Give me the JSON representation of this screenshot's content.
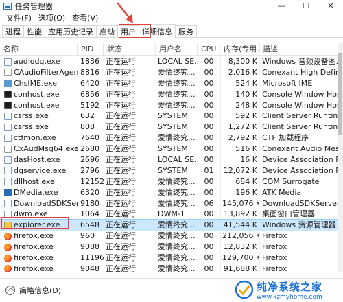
{
  "window": {
    "title": "任务管理器",
    "minimize": "—",
    "maximize": "☐",
    "close": "✕"
  },
  "menu": [
    "文件(F)",
    "选项(O)",
    "查看(V)"
  ],
  "tabs": [
    "进程",
    "性能",
    "应用历史记录",
    "启动",
    "用户",
    "详细信息",
    "服务"
  ],
  "active_tab_index": 5,
  "columns": [
    "名称",
    "PID",
    "状态",
    "用户名",
    "CPU",
    "内存(专用...",
    "描述"
  ],
  "rows": [
    {
      "icon": "speaker-icon",
      "name": "audiodg.exe",
      "pid": "1836",
      "status": "正在运行",
      "user": "LOCAL SE...",
      "cpu": "00",
      "mem": "8,300 K",
      "desc": "Windows 音频设备图..."
    },
    {
      "icon": "conexant-icon",
      "name": "CAudioFilterAgent...",
      "pid": "8816",
      "status": "正在运行",
      "user": "爱情终究...",
      "cpu": "00",
      "mem": "2,016 K",
      "desc": "Conexant High Definiti..."
    },
    {
      "icon": "ime-icon",
      "name": "ChsIME.exe",
      "pid": "6420",
      "status": "正在运行",
      "user": "爱情终究...",
      "cpu": "00",
      "mem": "524 K",
      "desc": "Microsoft IME"
    },
    {
      "icon": "console-icon",
      "name": "conhost.exe",
      "pid": "6856",
      "status": "正在运行",
      "user": "爱情终究...",
      "cpu": "00",
      "mem": "140 K",
      "desc": "Console Window Host"
    },
    {
      "icon": "console-icon",
      "name": "conhost.exe",
      "pid": "5192",
      "status": "正在运行",
      "user": "爱情终究...",
      "cpu": "00",
      "mem": "248 K",
      "desc": "Console Window Host"
    },
    {
      "icon": "system-process-icon",
      "name": "csrss.exe",
      "pid": "632",
      "status": "正在运行",
      "user": "SYSTEM",
      "cpu": "00",
      "mem": "592 K",
      "desc": "Client Server Runtime ..."
    },
    {
      "icon": "system-process-icon",
      "name": "csrss.exe",
      "pid": "808",
      "status": "正在运行",
      "user": "SYSTEM",
      "cpu": "00",
      "mem": "1,272 K",
      "desc": "Client Server Runtime ..."
    },
    {
      "icon": "ctf-icon",
      "name": "ctfmon.exe",
      "pid": "7640",
      "status": "正在运行",
      "user": "爱情终究...",
      "cpu": "00",
      "mem": "2,792 K",
      "desc": "CTF 加载程序"
    },
    {
      "icon": "conexant-icon",
      "name": "CxAudMsg64.exe",
      "pid": "2680",
      "status": "正在运行",
      "user": "SYSTEM",
      "cpu": "00",
      "mem": "516 K",
      "desc": "Conexant Audio Mess..."
    },
    {
      "icon": "system-process-icon",
      "name": "dasHost.exe",
      "pid": "2696",
      "status": "正在运行",
      "user": "LOCAL SE...",
      "cpu": "00",
      "mem": "16 K",
      "desc": "Device Association Fr..."
    },
    {
      "icon": "system-process-icon",
      "name": "dgservice.exe",
      "pid": "2796",
      "status": "正在运行",
      "user": "SYSTEM",
      "cpu": "01",
      "mem": "12,072 K",
      "desc": "Device Association Fr..."
    },
    {
      "icon": "system-process-icon",
      "name": "dllhost.exe",
      "pid": "12152",
      "status": "正在运行",
      "user": "爱情终究...",
      "cpu": "00",
      "mem": "684 K",
      "desc": "COM Surrogate"
    },
    {
      "icon": "dmedia-icon",
      "name": "DMedia.exe",
      "pid": "6320",
      "status": "正在运行",
      "user": "爱情终究...",
      "cpu": "00",
      "mem": "196 K",
      "desc": "ATK Media"
    },
    {
      "icon": "download-icon",
      "name": "DownloadSDKServ...",
      "pid": "9180",
      "status": "正在运行",
      "user": "爱情终究...",
      "cpu": "06",
      "mem": "145,076 K",
      "desc": "DownloadSDKServer"
    },
    {
      "icon": "dwm-icon",
      "name": "dwm.exe",
      "pid": "1064",
      "status": "正在运行",
      "user": "DWM-1",
      "cpu": "00",
      "mem": "13,892 K",
      "desc": "桌面窗口管理器"
    },
    {
      "icon": "folder-icon",
      "name": "explorer.exe",
      "pid": "6548",
      "status": "正在运行",
      "user": "爱情终究...",
      "cpu": "00",
      "mem": "41,544 K",
      "desc": "Windows 资源管理器"
    },
    {
      "icon": "firefox-icon",
      "name": "firefox.exe",
      "pid": "960",
      "status": "正在运行",
      "user": "爱情终究...",
      "cpu": "00",
      "mem": "212,056 K",
      "desc": "Firefox"
    },
    {
      "icon": "firefox-icon",
      "name": "firefox.exe",
      "pid": "9088",
      "status": "正在运行",
      "user": "爱情终究...",
      "cpu": "00",
      "mem": "12,832 K",
      "desc": "Firefox"
    },
    {
      "icon": "firefox-icon",
      "name": "firefox.exe",
      "pid": "11196",
      "status": "正在运行",
      "user": "爱情终究...",
      "cpu": "00",
      "mem": "129,700 K",
      "desc": "Firefox"
    },
    {
      "icon": "firefox-icon",
      "name": "firefox.exe",
      "pid": "9048",
      "status": "正在运行",
      "user": "爱情终究...",
      "cpu": "00",
      "mem": "91,688 K",
      "desc": "Firefox"
    }
  ],
  "selected_row_index": 15,
  "footer": {
    "label": "简略信息(D)"
  },
  "watermark": {
    "title": "纯净系统之家",
    "url": "www.kzmyhome.com"
  },
  "colors": {
    "selection": "#cce8ff",
    "annotation": "#e0403a",
    "watermark": "#1a6fd8"
  }
}
